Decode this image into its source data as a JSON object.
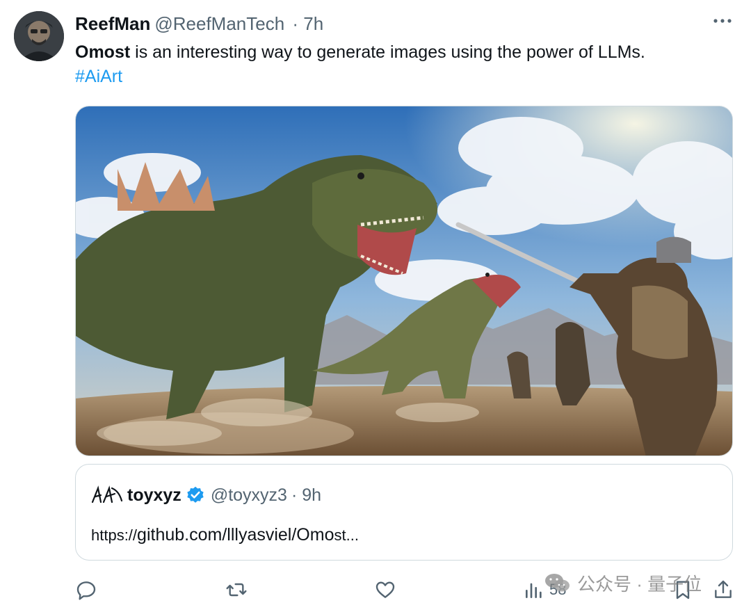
{
  "tweet": {
    "author_name": "ReefMan",
    "author_handle": "@ReefManTech",
    "time": "· 7h",
    "text_bold": "Omost",
    "text_rest": " is an interesting way to generate images using the power of LLMs.",
    "hashtag": "#AiArt",
    "avatar_icon": "user-avatar",
    "more_icon": "more-horizontal-icon"
  },
  "quote": {
    "author_name": "toyxyz",
    "author_handle": "@toyxyz3",
    "time": "· 9h",
    "link_prefix": "https://",
    "link_main": "github.com/lllyasviel/Omo",
    "link_tail": "st...",
    "verified_color": "#1d9bf0"
  },
  "actions": {
    "reply_icon": "reply-icon",
    "retweet_icon": "retweet-icon",
    "like_icon": "heart-icon",
    "views_icon": "analytics-icon",
    "views_count": "58",
    "bookmark_icon": "bookmark-icon",
    "share_icon": "share-icon"
  },
  "watermark": {
    "text": "公众号 · 量子位"
  },
  "colors": {
    "accent": "#1d9bf0",
    "secondary_text": "#536471",
    "border": "#cfd9de"
  }
}
